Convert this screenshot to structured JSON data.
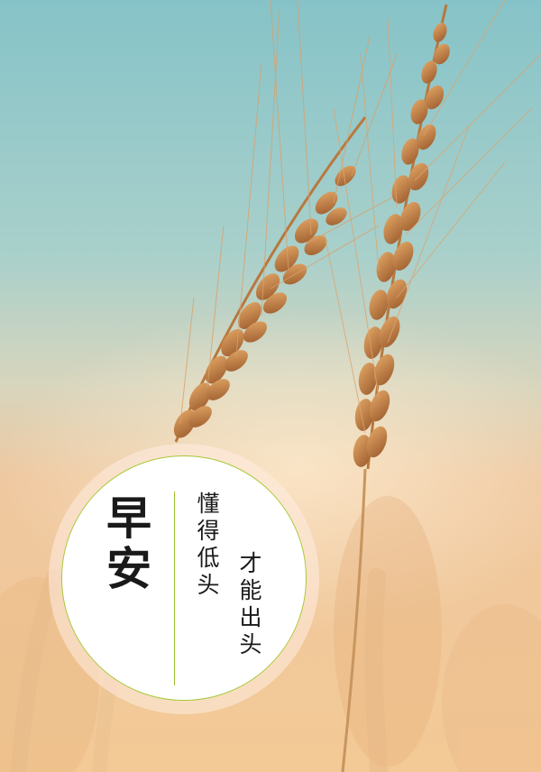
{
  "greeting": {
    "title": "早安",
    "line1": "懂得低头",
    "line2": "才能出头"
  },
  "colors": {
    "sky_top": "#8fc6c9",
    "field": "#f2c998",
    "wheat": "#c98a4c",
    "badge_border": "#a8c93a"
  }
}
